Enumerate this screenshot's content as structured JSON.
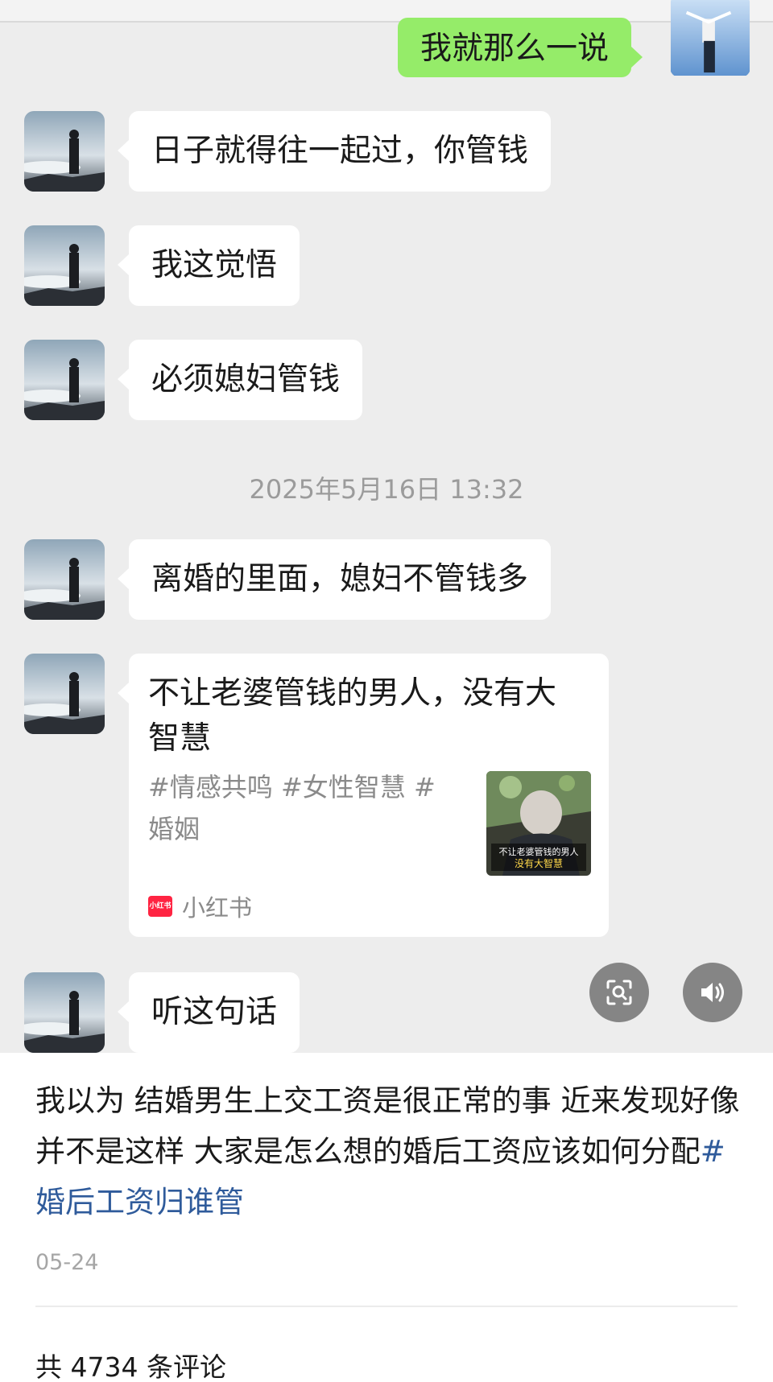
{
  "chat": {
    "messages": [
      {
        "text": "我就那么一说",
        "sender": "self"
      },
      {
        "text": "日子就得往一起过，你管钱",
        "sender": "other"
      },
      {
        "text": "我这觉悟",
        "sender": "other"
      },
      {
        "text": "必须媳妇管钱",
        "sender": "other"
      },
      {
        "text": "离婚的里面，媳妇不管钱多",
        "sender": "other"
      },
      {
        "text": "听这句话",
        "sender": "other"
      }
    ],
    "timestamp": "2025年5月16日 13:32",
    "shared_card": {
      "title": "不让老婆管钱的男人，没有大智慧",
      "tags": "#情感共鸣 #女性智慧 #婚姻",
      "source": "小红书",
      "logo_text": "小红书",
      "thumb_caption_line1": "不让老婆管钱的男人",
      "thumb_caption_line2": "没有大智慧"
    },
    "icons": {
      "scan": "scan-text-icon",
      "speaker": "speaker-icon"
    }
  },
  "post": {
    "body": "我以为 结婚男生上交工资是很正常的事 近来发现好像并不是这样 大家是怎么想的婚后工资应该如何分配",
    "hashtag": "#婚后工资归谁管",
    "date": "05-24",
    "comments_label": "共 4734 条评论"
  },
  "colors": {
    "chat_bg": "#ededed",
    "sent_bubble": "#95ec69",
    "received_bubble": "#ffffff",
    "hashtag": "#2f5b9b",
    "xhs_red": "#ff2442"
  }
}
